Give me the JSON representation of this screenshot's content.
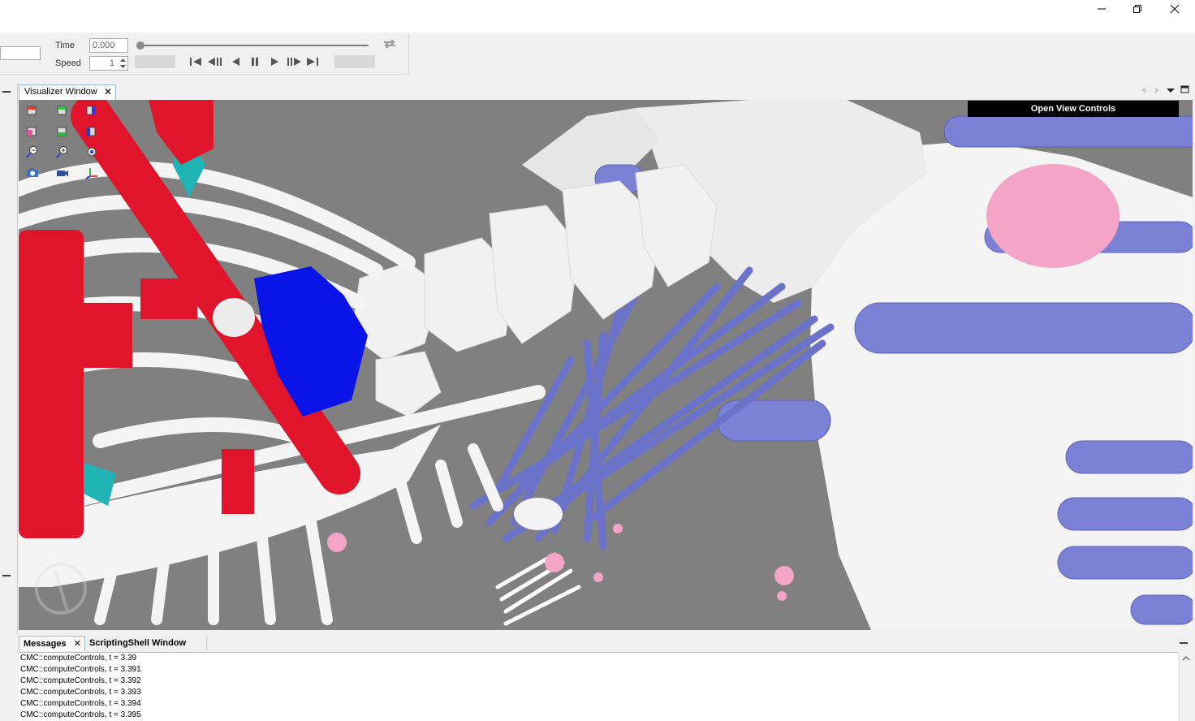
{
  "window_controls": {
    "minimize_icon": "minimize-icon",
    "restore_icon": "restore-icon",
    "close_icon": "close-icon"
  },
  "transport": {
    "time_label": "Time",
    "time_value": "0.000",
    "speed_label": "Speed",
    "speed_value": "1",
    "slider_fraction": 0.0
  },
  "visualizer": {
    "tab_label": "Visualizer Window",
    "open_view_controls_label": "Open View Controls"
  },
  "bottom_tabs": {
    "messages_label": "Messages",
    "scripting_label": "ScriptingShell Window"
  },
  "messages": [
    "CMC::computeControls, t = 3.39",
    "CMC::computeControls, t = 3.391",
    "CMC::computeControls, t = 3.392",
    "CMC::computeControls, t = 3.393",
    "CMC::computeControls, t = 3.394",
    "CMC::computeControls, t = 3.395"
  ],
  "colors": {
    "viewport_bg": "#808080",
    "bone": "#f3f3f3",
    "muscle_red": "#e0142a",
    "muscle_blue": "#7b82d6",
    "selected_blue": "#0a14e8",
    "marker_pink": "#f3a4c7",
    "teal": "#1fb3b3"
  }
}
